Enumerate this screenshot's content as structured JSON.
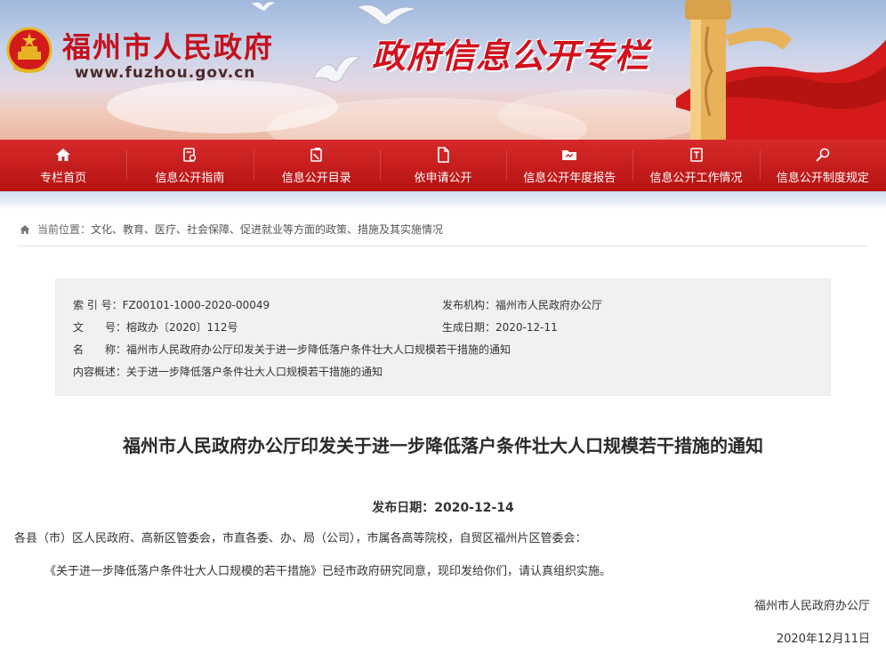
{
  "banner": {
    "site_title": "福州市人民政府",
    "site_url": "www.fuzhou.gov.cn",
    "column_title": "政府信息公开专栏"
  },
  "nav": {
    "items": [
      {
        "label": "专栏首页",
        "icon": "home-icon"
      },
      {
        "label": "信息公开指南",
        "icon": "guide-icon"
      },
      {
        "label": "信息公开目录",
        "icon": "catalog-icon"
      },
      {
        "label": "依申请公开",
        "icon": "document-icon"
      },
      {
        "label": "信息公开年度报告",
        "icon": "report-folder-icon"
      },
      {
        "label": "信息公开工作情况",
        "icon": "work-report-icon"
      },
      {
        "label": "信息公开制度规定",
        "icon": "regulation-search-icon"
      }
    ]
  },
  "breadcrumb": {
    "label": "当前位置：",
    "path": "文化、教育、医疗、社会保障、促进就业等方面的政策、措施及其实施情况"
  },
  "meta": {
    "index_label": "索 引 号：",
    "index_value": "FZ00101-1000-2020-00049",
    "publisher_label": "发布机构：",
    "publisher_value": "福州市人民政府办公厅",
    "doc_no_label": "文　　号：",
    "doc_no_value": "榕政办〔2020〕112号",
    "created_label": "生成日期：",
    "created_value": "2020-12-11",
    "name_label": "名　　称：",
    "name_value": "福州市人民政府办公厅印发关于进一步降低落户条件壮大人口规模若干措施的通知",
    "summary_label": "内容概述：",
    "summary_value": "关于进一步降低落户条件壮大人口规模若干措施的通知"
  },
  "article": {
    "title": "福州市人民政府办公厅印发关于进一步降低落户条件壮大人口规模若干措施的通知",
    "publish_date": "发布日期：2020-12-14",
    "para1": "各县（市）区人民政府、高新区管委会，市直各委、办、局（公司），市属各高等院校，自贸区福州片区管委会：",
    "para2": "《关于进一步降低落户条件壮大人口规模的若干措施》已经市政府研究同意，现印发给你们，请认真组织实施。",
    "signature": "福州市人民政府办公厅",
    "sign_date": "2020年12月11日"
  },
  "colors": {
    "brand_red": "#c4121c",
    "nav_red": "#c41a1a"
  }
}
